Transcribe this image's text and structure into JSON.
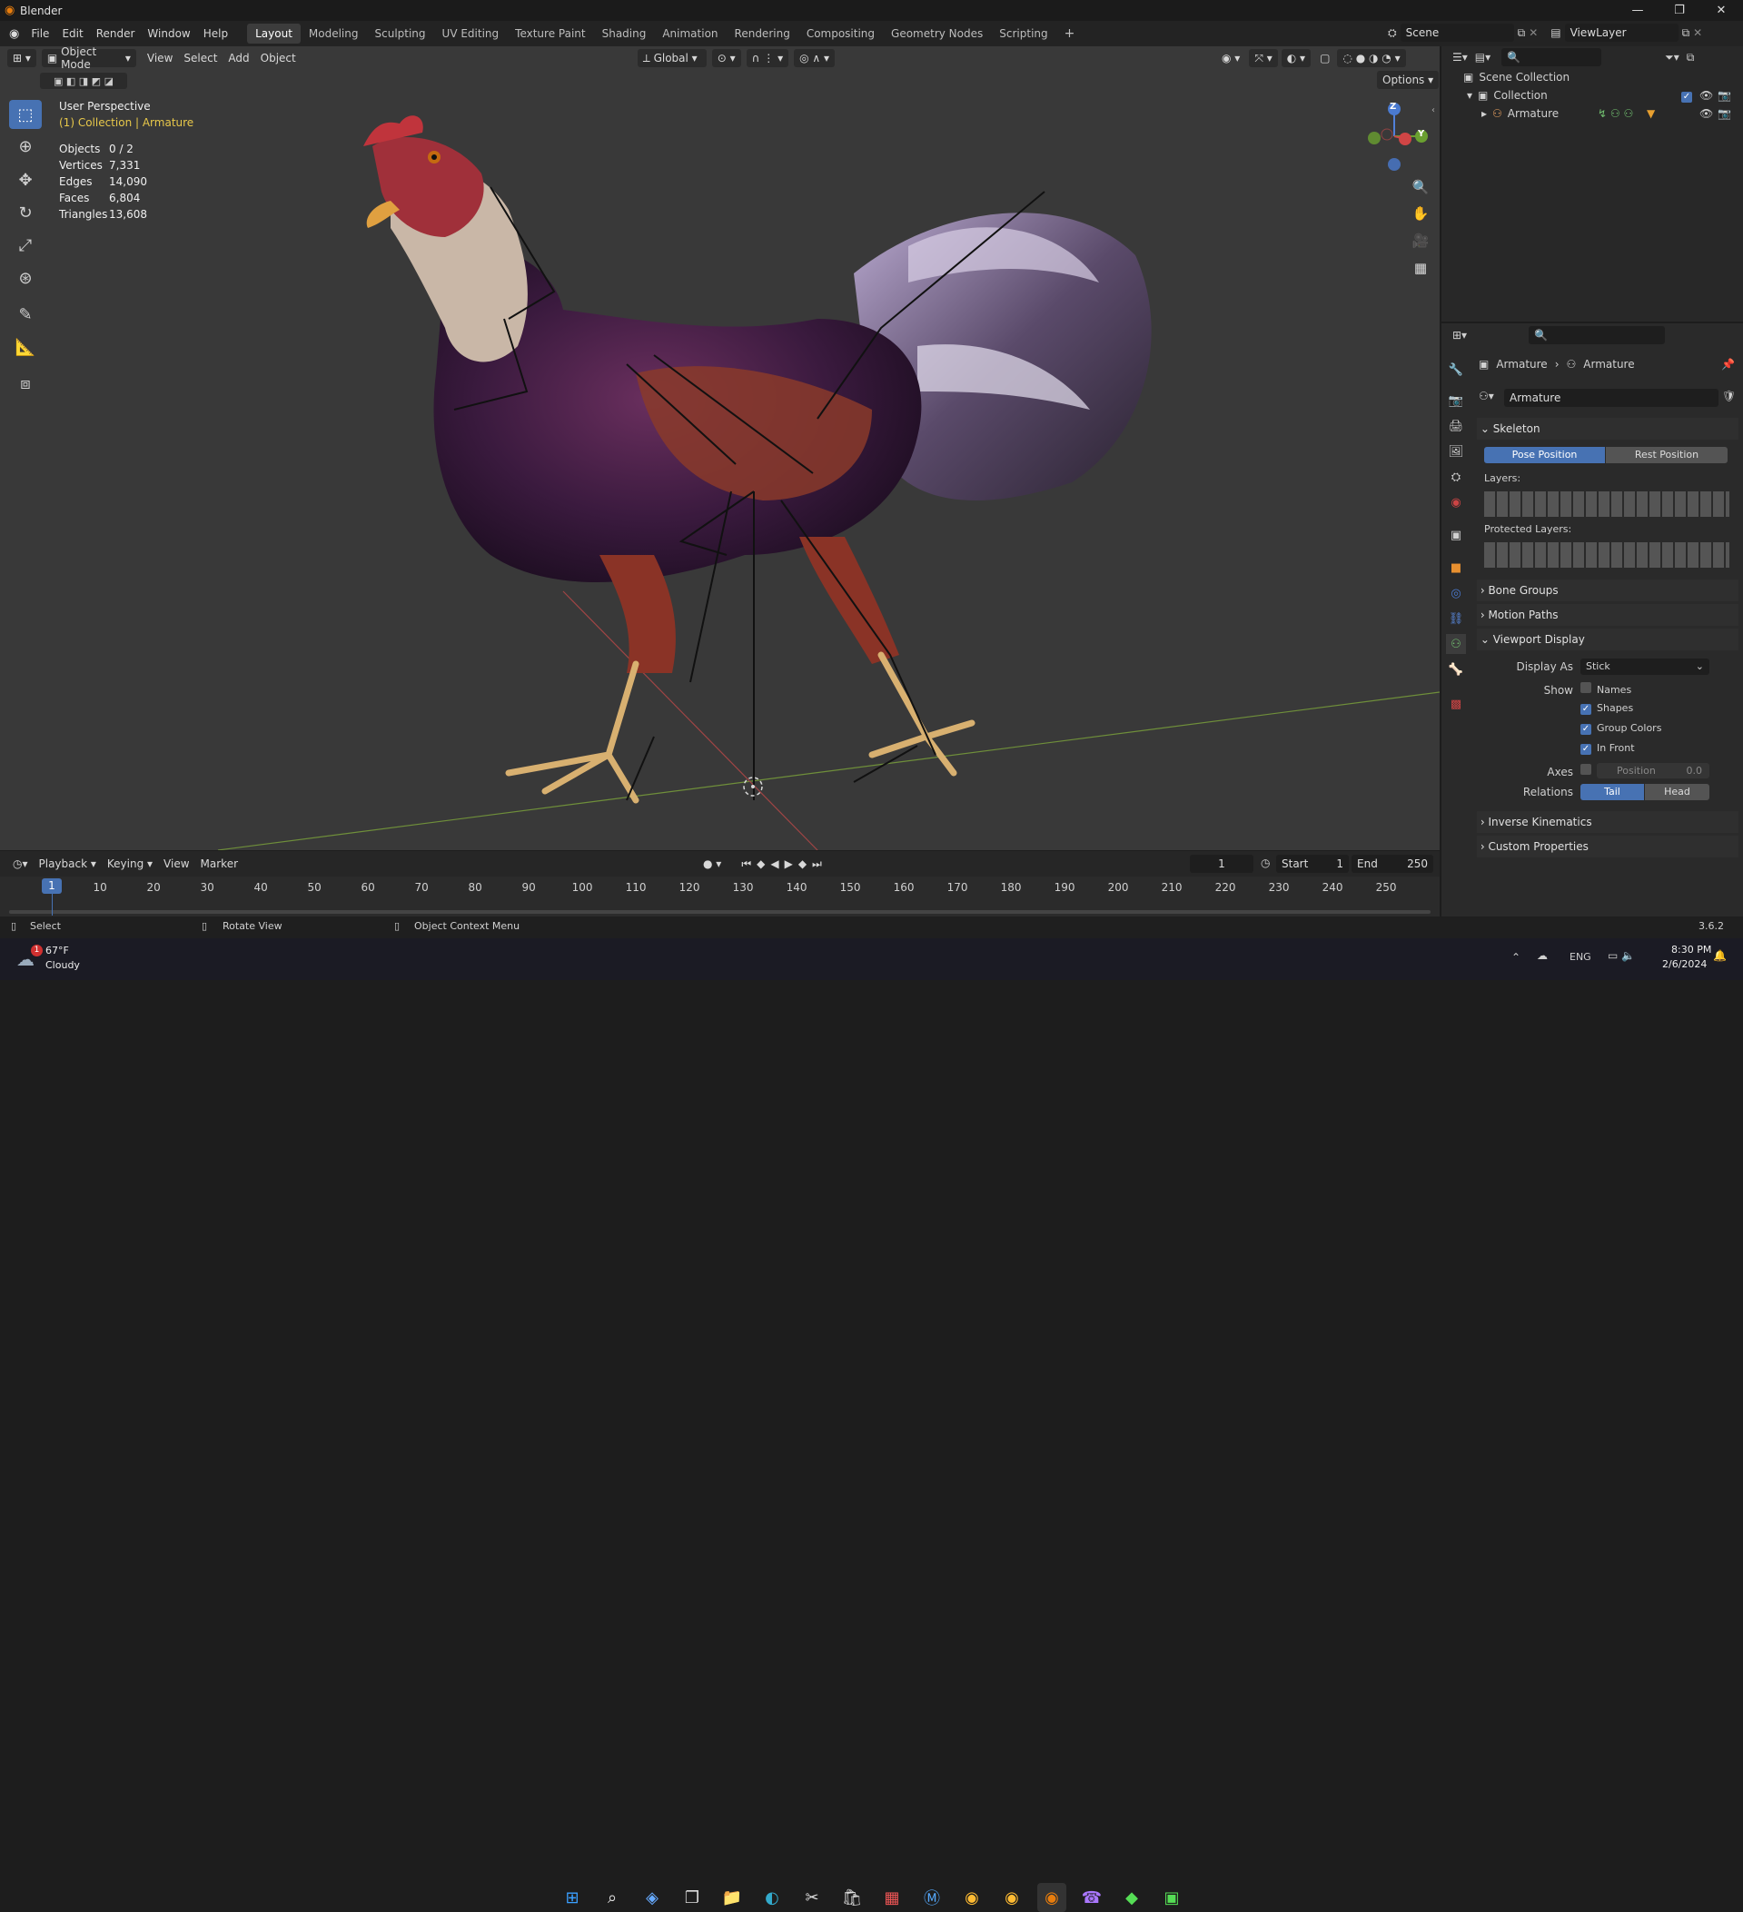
{
  "window": {
    "title": "Blender",
    "version": "3.6.2"
  },
  "menu": [
    "File",
    "Edit",
    "Render",
    "Window",
    "Help"
  ],
  "workspaces": [
    "Layout",
    "Modeling",
    "Sculpting",
    "UV Editing",
    "Texture Paint",
    "Shading",
    "Animation",
    "Rendering",
    "Compositing",
    "Geometry Nodes",
    "Scripting"
  ],
  "active_workspace": "Layout",
  "scene": {
    "name": "Scene",
    "view_layer": "ViewLayer"
  },
  "viewport_header": {
    "mode": "Object Mode",
    "menus": [
      "View",
      "Select",
      "Add",
      "Object"
    ],
    "orientation": "Global",
    "options": "Options"
  },
  "overlay": {
    "view_name": "User Perspective",
    "context": "(1) Collection | Armature"
  },
  "stats": [
    {
      "label": "Objects",
      "value": "0 / 2"
    },
    {
      "label": "Vertices",
      "value": "7,331"
    },
    {
      "label": "Edges",
      "value": "14,090"
    },
    {
      "label": "Faces",
      "value": "6,804"
    },
    {
      "label": "Triangles",
      "value": "13,608"
    }
  ],
  "gizmo": {
    "z": "Z",
    "y": "Y"
  },
  "outliner": {
    "root": "Scene Collection",
    "collection": "Collection",
    "object": "Armature"
  },
  "properties": {
    "breadcrumb_a": "Armature",
    "breadcrumb_b": "Armature",
    "datablock": "Armature",
    "skeleton": {
      "title": "Skeleton",
      "pose_position": "Pose Position",
      "rest_position": "Rest Position",
      "layers": "Layers:",
      "protected_layers": "Protected Layers:"
    },
    "bone_groups": "Bone Groups",
    "motion_paths": "Motion Paths",
    "viewport_display": {
      "title": "Viewport Display",
      "display_as_label": "Display As",
      "display_as_value": "Stick",
      "show_label": "Show",
      "names": "Names",
      "shapes": "Shapes",
      "group_colors": "Group Colors",
      "in_front": "In Front",
      "axes_label": "Axes",
      "position_label": "Position",
      "position_value": "0.0",
      "relations_label": "Relations",
      "tail": "Tail",
      "head": "Head"
    },
    "inverse_kinematics": "Inverse Kinematics",
    "custom_properties": "Custom Properties"
  },
  "timeline": {
    "menus": [
      "Playback",
      "Keying",
      "View",
      "Marker"
    ],
    "current_frame": "1",
    "start_label": "Start",
    "start": "1",
    "end_label": "End",
    "end": "250",
    "ticks": [
      "10",
      "20",
      "30",
      "40",
      "50",
      "60",
      "70",
      "80",
      "90",
      "100",
      "110",
      "120",
      "130",
      "140",
      "150",
      "160",
      "170",
      "180",
      "190",
      "200",
      "210",
      "220",
      "230",
      "240",
      "250"
    ]
  },
  "statusbar": {
    "select": "Select",
    "rotate": "Rotate View",
    "context_menu": "Object Context Menu"
  },
  "taskbar": {
    "weather_temp": "67°F",
    "weather_desc": "Cloudy",
    "lang": "ENG",
    "time": "8:30 PM",
    "date": "2/6/2024",
    "badge": "1"
  }
}
